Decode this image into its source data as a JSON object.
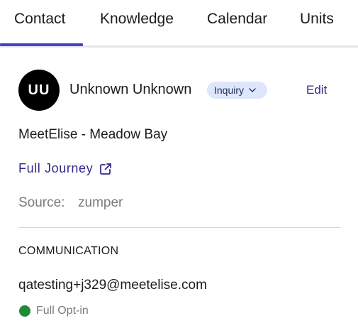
{
  "tabs": [
    {
      "label": "Contact",
      "active": true
    },
    {
      "label": "Knowledge",
      "active": false
    },
    {
      "label": "Calendar",
      "active": false
    },
    {
      "label": "Units",
      "active": false
    }
  ],
  "contact": {
    "initials": "UU",
    "name": "Unknown Unknown",
    "status": "Inquiry",
    "edit_label": "Edit",
    "organization": "MeetElise - Meadow Bay",
    "journey_link": "Full Journey",
    "source_label": "Source:",
    "source_value": "zumper"
  },
  "communication": {
    "heading": "COMMUNICATION",
    "email": "qatesting+j329@meetelise.com",
    "opt_in_status": "Full Opt-in",
    "opt_in_color": "#1f8a3a"
  },
  "colors": {
    "accent": "#4a3fcf",
    "link": "#2e2a8a",
    "badge_bg": "#dde6fb",
    "muted_text": "#7a7a7a"
  },
  "icons": {
    "status_dropdown": "chevron-down-icon",
    "journey": "external-link-icon",
    "opt_in": "status-dot-icon"
  }
}
